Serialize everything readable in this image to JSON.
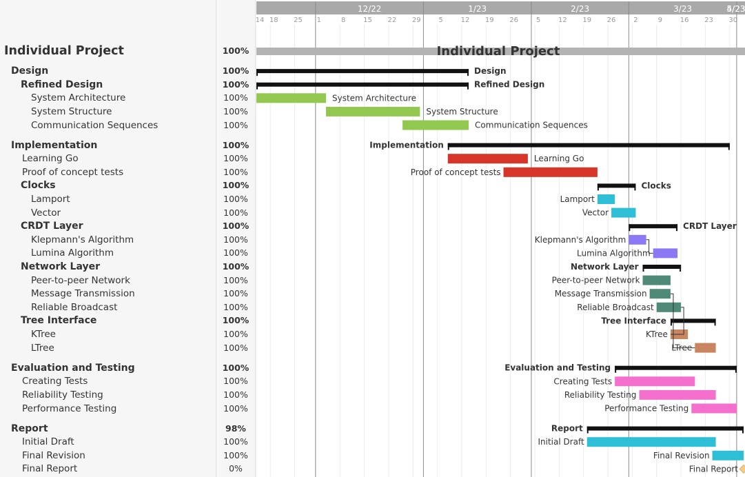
{
  "timeline": {
    "months": [
      {
        "label": "12/22",
        "date": "2022-12-01"
      },
      {
        "label": "1/23",
        "date": "2023-01-01"
      },
      {
        "label": "2/23",
        "date": "2023-02-01"
      },
      {
        "label": "3/23",
        "date": "2023-03-01"
      },
      {
        "label": "4/23",
        "date": "2023-04-01"
      },
      {
        "label": "5/23",
        "date": "2023-05-01"
      }
    ],
    "days": [
      {
        "label": "14",
        "date": "2022-11-14"
      },
      {
        "label": "18",
        "date": "2022-11-18"
      },
      {
        "label": "25",
        "date": "2022-11-25"
      },
      {
        "label": "1",
        "date": "2022-12-01"
      },
      {
        "label": "8",
        "date": "2022-12-08"
      },
      {
        "label": "15",
        "date": "2022-12-15"
      },
      {
        "label": "22",
        "date": "2022-12-22"
      },
      {
        "label": "29",
        "date": "2022-12-29"
      },
      {
        "label": "5",
        "date": "2023-01-05"
      },
      {
        "label": "12",
        "date": "2023-01-12"
      },
      {
        "label": "19",
        "date": "2023-01-19"
      },
      {
        "label": "26",
        "date": "2023-01-26"
      },
      {
        "label": "5",
        "date": "2023-02-02"
      },
      {
        "label": "12",
        "date": "2023-02-09"
      },
      {
        "label": "19",
        "date": "2023-02-16"
      },
      {
        "label": "26",
        "date": "2023-02-23"
      },
      {
        "label": "2",
        "date": "2023-03-02"
      },
      {
        "label": "9",
        "date": "2023-03-09"
      },
      {
        "label": "16",
        "date": "2023-03-16"
      },
      {
        "label": "23",
        "date": "2023-03-23"
      },
      {
        "label": "30",
        "date": "2023-03-30"
      }
    ]
  },
  "colors": {
    "summary": "#111111",
    "design": "#92c84f",
    "implementation": "#d8352a",
    "clocks": "#2ebfd6",
    "crdt": "#8b78f5",
    "network": "#4f8a78",
    "tree": "#c98560",
    "testing": "#f570cc",
    "report": "#2ebfd6",
    "milestone": "#f5c98a",
    "project": "#b3b3b3"
  },
  "rows": [
    {
      "name": "Individual Project",
      "pct": "100%",
      "level": "title",
      "kind": "project",
      "start": "2022-11-14",
      "end": "2023-05-04",
      "label": "Individual Project",
      "label_pos": "center"
    },
    {
      "name": "Design",
      "pct": "100%",
      "level": "group",
      "kind": "summary",
      "start": "2022-11-14",
      "end": "2023-01-14",
      "label": "Design",
      "label_pos": "right",
      "gap": true
    },
    {
      "name": "Refined Design",
      "pct": "100%",
      "level": "subgroup",
      "kind": "summary",
      "start": "2022-11-14",
      "end": "2023-01-14",
      "label": "Refined Design",
      "label_pos": "right"
    },
    {
      "name": "System Architecture",
      "pct": "100%",
      "level": "task2",
      "kind": "task",
      "color": "design",
      "start": "2022-11-14",
      "end": "2022-12-04",
      "label": "System Architecture",
      "label_pos": "right"
    },
    {
      "name": "System Structure",
      "pct": "100%",
      "level": "task2",
      "kind": "task",
      "color": "design",
      "start": "2022-12-04",
      "end": "2022-12-31",
      "label": "System Structure",
      "label_pos": "right"
    },
    {
      "name": "Communication Sequences",
      "pct": "100%",
      "level": "task2",
      "kind": "task",
      "color": "design",
      "start": "2022-12-26",
      "end": "2023-01-14",
      "label": "Communication Sequences",
      "label_pos": "right"
    },
    {
      "name": "Implementation",
      "pct": "100%",
      "level": "group",
      "kind": "summary",
      "start": "2023-01-08",
      "end": "2023-03-30",
      "label": "Implementation",
      "label_pos": "left",
      "gap": true
    },
    {
      "name": "Learning Go",
      "pct": "100%",
      "level": "task1",
      "kind": "task",
      "color": "implementation",
      "start": "2023-01-08",
      "end": "2023-01-31",
      "label": "Learning Go",
      "label_pos": "right"
    },
    {
      "name": "Proof of concept tests",
      "pct": "100%",
      "level": "task1",
      "kind": "task",
      "color": "implementation",
      "start": "2023-01-24",
      "end": "2023-02-20",
      "label": "Proof of concept tests",
      "label_pos": "left"
    },
    {
      "name": "Clocks",
      "pct": "100%",
      "level": "subgroup",
      "kind": "summary",
      "start": "2023-02-20",
      "end": "2023-03-03",
      "label": "Clocks",
      "label_pos": "right"
    },
    {
      "name": "Lamport",
      "pct": "100%",
      "level": "task2",
      "kind": "task",
      "color": "clocks",
      "start": "2023-02-20",
      "end": "2023-02-25",
      "label": "Lamport",
      "label_pos": "left"
    },
    {
      "name": "Vector",
      "pct": "100%",
      "level": "task2",
      "kind": "task",
      "color": "clocks",
      "start": "2023-02-24",
      "end": "2023-03-03",
      "label": "Vector",
      "label_pos": "left"
    },
    {
      "name": "CRDT Layer",
      "pct": "100%",
      "level": "subgroup",
      "kind": "summary",
      "start": "2023-03-01",
      "end": "2023-03-15",
      "label": "CRDT Layer",
      "label_pos": "right"
    },
    {
      "name": "Klepmann's Algorithm",
      "pct": "100%",
      "level": "task2",
      "kind": "task",
      "color": "crdt",
      "start": "2023-03-01",
      "end": "2023-03-06",
      "label": "Klepmann's Algorithm",
      "label_pos": "left"
    },
    {
      "name": "Lumina Algorithm",
      "pct": "100%",
      "level": "task2",
      "kind": "task",
      "color": "crdt",
      "start": "2023-03-08",
      "end": "2023-03-15",
      "label": "Lumina Algorithm",
      "label_pos": "left"
    },
    {
      "name": "Network Layer",
      "pct": "100%",
      "level": "subgroup",
      "kind": "summary",
      "start": "2023-03-05",
      "end": "2023-03-16",
      "label": "Network Layer",
      "label_pos": "left"
    },
    {
      "name": "Peer-to-peer Network",
      "pct": "100%",
      "level": "task2",
      "kind": "task",
      "color": "network",
      "start": "2023-03-05",
      "end": "2023-03-13",
      "label": "Peer-to-peer Network",
      "label_pos": "left"
    },
    {
      "name": "Message Transmission",
      "pct": "100%",
      "level": "task2",
      "kind": "task",
      "color": "network",
      "start": "2023-03-07",
      "end": "2023-03-13",
      "label": "Message Transmission",
      "label_pos": "left"
    },
    {
      "name": "Reliable Broadcast",
      "pct": "100%",
      "level": "task2",
      "kind": "task",
      "color": "network",
      "start": "2023-03-09",
      "end": "2023-03-16",
      "label": "Reliable Broadcast",
      "label_pos": "left"
    },
    {
      "name": "Tree Interface",
      "pct": "100%",
      "level": "subgroup",
      "kind": "summary",
      "start": "2023-03-13",
      "end": "2023-03-26",
      "label": "Tree Interface",
      "label_pos": "left"
    },
    {
      "name": "KTree",
      "pct": "100%",
      "level": "task2",
      "kind": "task",
      "color": "tree",
      "start": "2023-03-13",
      "end": "2023-03-18",
      "label": "KTree",
      "label_pos": "left"
    },
    {
      "name": "LTree",
      "pct": "100%",
      "level": "task2",
      "kind": "task",
      "color": "tree",
      "start": "2023-03-20",
      "end": "2023-03-26",
      "label": "LTree",
      "label_pos": "left"
    },
    {
      "name": "Evaluation and Testing",
      "pct": "100%",
      "level": "group",
      "kind": "summary",
      "start": "2023-02-25",
      "end": "2023-04-01",
      "label": "Evaluation and Testing",
      "label_pos": "left",
      "gap": true
    },
    {
      "name": "Creating Tests",
      "pct": "100%",
      "level": "task1",
      "kind": "task",
      "color": "testing",
      "start": "2023-02-25",
      "end": "2023-03-20",
      "label": "Creating Tests",
      "label_pos": "left"
    },
    {
      "name": "Reliability Testing",
      "pct": "100%",
      "level": "task1",
      "kind": "task",
      "color": "testing",
      "start": "2023-03-04",
      "end": "2023-03-26",
      "label": "Reliability Testing",
      "label_pos": "left"
    },
    {
      "name": "Performance Testing",
      "pct": "100%",
      "level": "task1",
      "kind": "task",
      "color": "testing",
      "start": "2023-03-19",
      "end": "2023-04-01",
      "label": "Performance Testing",
      "label_pos": "left"
    },
    {
      "name": "Report",
      "pct": "98%",
      "level": "group",
      "kind": "summary",
      "start": "2023-02-17",
      "end": "2023-04-03",
      "label": "Report",
      "label_pos": "left",
      "gap": true
    },
    {
      "name": "Initial Draft",
      "pct": "100%",
      "level": "task1",
      "kind": "task",
      "color": "report",
      "start": "2023-02-17",
      "end": "2023-03-26",
      "label": "Initial Draft",
      "label_pos": "left"
    },
    {
      "name": "Final Revision",
      "pct": "100%",
      "level": "task1",
      "kind": "task",
      "color": "report",
      "start": "2023-03-25",
      "end": "2023-04-03",
      "label": "Final Revision",
      "label_pos": "left"
    },
    {
      "name": "Final Report",
      "pct": "0%",
      "level": "task1",
      "kind": "milestone",
      "color": "milestone",
      "start": "2023-04-03",
      "end": "2023-04-03",
      "label": "Final Report",
      "label_pos": "left"
    }
  ]
}
